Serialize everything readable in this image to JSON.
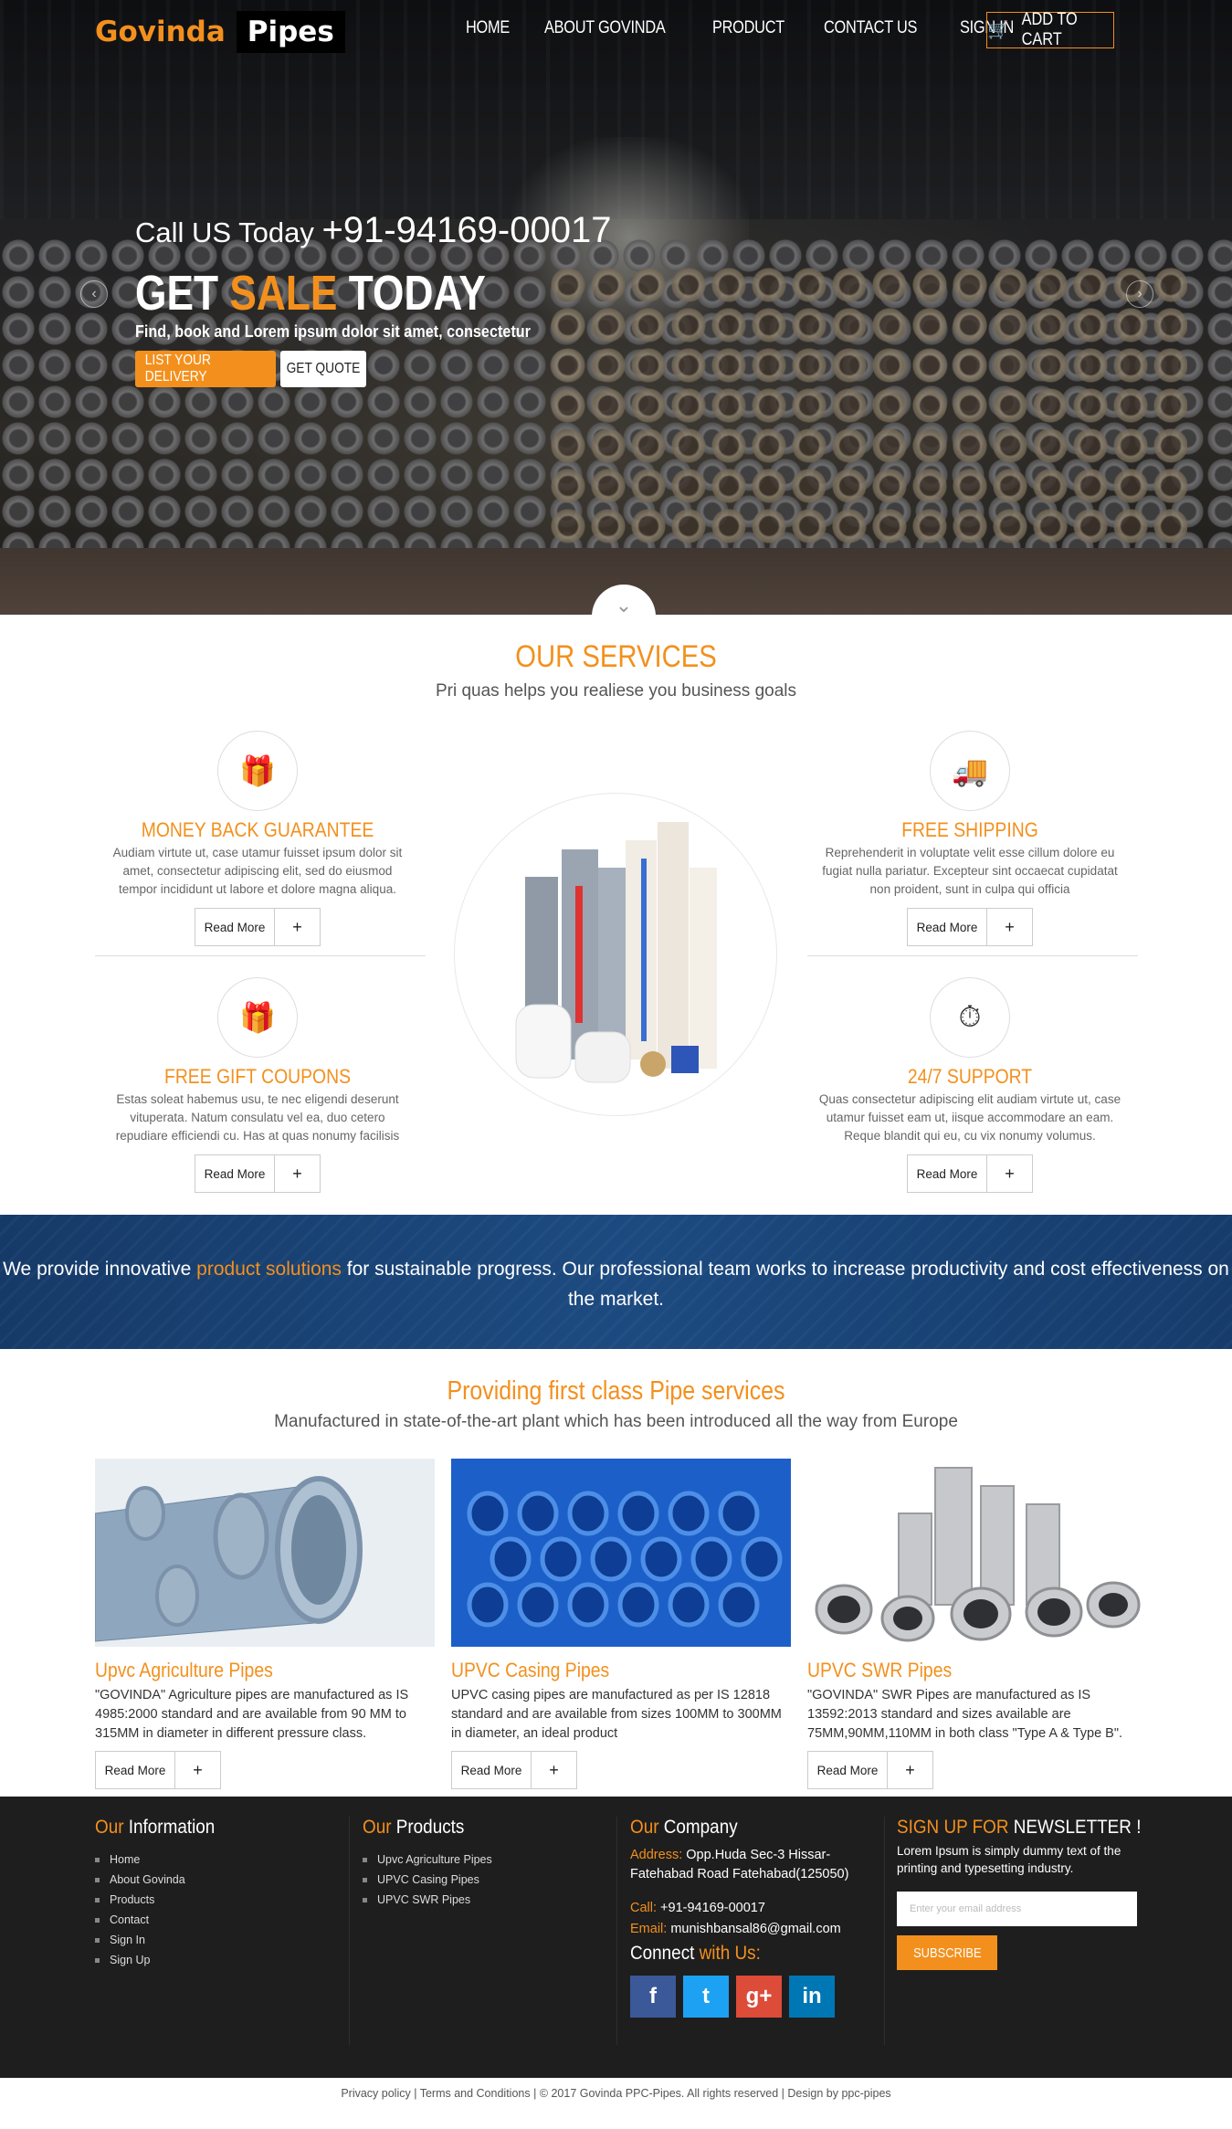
{
  "brand": {
    "part1": "Govinda",
    "part2": "Pipes"
  },
  "nav": [
    "HOME",
    "ABOUT GOVINDA",
    "PRODUCT",
    "CONTACT US",
    "SIGN IN"
  ],
  "cart_label": "ADD TO CART",
  "hero": {
    "call_prefix": "Call US Today",
    "phone": "+91-94169-00017",
    "headline_a": "GET",
    "headline_b": "SALE",
    "headline_c": "TODAY",
    "subtitle": "Find, book and Lorem ipsum dolor sit amet, consectetur",
    "btn_delivery": "LIST YOUR DELIVERY",
    "btn_quote": "GET QUOTE"
  },
  "services": {
    "title": "OUR SERVICES",
    "subtitle": "Pri quas helps you realiese you business goals",
    "items": [
      {
        "title": "MONEY BACK GUARANTEE",
        "text": "Audiam virtute ut, case utamur fuisset ipsum dolor sit amet, consectetur adipiscing elit, sed do eiusmod tempor incididunt ut labore et dolore magna aliqua.",
        "icon": "gift-icon"
      },
      {
        "title": "FREE SHIPPING",
        "text": "Reprehenderit in voluptate velit esse cillum dolore eu fugiat nulla pariatur. Excepteur sint occaecat cupidatat non proident, sunt in culpa qui officia",
        "icon": "truck-icon"
      },
      {
        "title": "FREE GIFT COUPONS",
        "text": "Estas soleat habemus usu, te nec eligendi deserunt vituperata. Natum consulatu vel ea, duo cetero repudiare efficiendi cu. Has at quas nonumy facilisis",
        "icon": "gift-icon"
      },
      {
        "title": "24/7 SUPPORT",
        "text": "Quas consectetur adipiscing elit audiam virtute ut, case utamur fuisset eam ut, iisque accommodare an eam. Reque blandit qui eu, cu vix nonumy volumus.",
        "icon": "support-icon"
      }
    ],
    "read_more": "Read More",
    "plus": "+"
  },
  "banner": {
    "before": "We provide innovative ",
    "highlight": "product solutions",
    "after": " for sustainable progress. Our professional team works to increase productivity and cost effectiveness on the market."
  },
  "products": {
    "title": "Providing first class Pipe services",
    "subtitle": "Manufactured in state-of-the-art plant which has been introduced all the way from Europe",
    "items": [
      {
        "title": "Upvc Agriculture Pipes",
        "text": "\"GOVINDA\" Agriculture pipes are manufactured as IS 4985:2000 standard and are available from 90 MM to 315MM in diameter in different pressure class."
      },
      {
        "title": "UPVC Casing Pipes",
        "text": "UPVC casing pipes are manufactured as per IS 12818 standard and are available from sizes 100MM to 300MM in diameter, an ideal product"
      },
      {
        "title": "UPVC SWR Pipes",
        "text": "\"GOVINDA\" SWR Pipes are manufactured as IS 13592:2013 standard and sizes available are 75MM,90MM,110MM in both class \"Type A & Type B\"."
      }
    ]
  },
  "footer": {
    "info": {
      "title_a": "Our",
      "title_b": " Information",
      "links": [
        "Home",
        "About Govinda",
        "Products",
        "Contact",
        "Sign In",
        "Sign Up"
      ]
    },
    "products": {
      "title_a": "Our",
      "title_b": " Products",
      "links": [
        "Upvc Agriculture Pipes",
        "UPVC Casing Pipes",
        "UPVC SWR Pipes"
      ]
    },
    "company": {
      "title_a": "Our",
      "title_b": " Company",
      "address_label": "Address:",
      "address": " Opp.Huda Sec-3 Hissar-Fatehabad Road Fatehabad(125050)",
      "call_label": "Call:",
      "call": " +91-94169-00017",
      "email_label": "Email:",
      "email": " munishbansal86@gmail.com",
      "connect_a": "Connect",
      "connect_b": " with Us:"
    },
    "newsletter": {
      "title_a": "SIGN UP FOR",
      "title_b": " NEWSLETTER !",
      "text": "Lorem Ipsum is simply dummy text of the printing and typesetting industry.",
      "placeholder": "Enter your email address",
      "button": "SUBSCRIBE"
    },
    "social": [
      {
        "icon": "facebook-icon",
        "glyph": "f",
        "color": "#3b5998"
      },
      {
        "icon": "twitter-icon",
        "glyph": "t",
        "color": "#1da1f2"
      },
      {
        "icon": "google-plus-icon",
        "glyph": "g+",
        "color": "#dd4b39"
      },
      {
        "icon": "linkedin-icon",
        "glyph": "in",
        "color": "#0077b5"
      }
    ],
    "copyright": "Privacy policy | Terms and Conditions | © 2017 Govinda PPC-Pipes. All rights reserved | Design by ppc-pipes"
  },
  "colors": {
    "accent": "#f3901d",
    "banner": "#1c4a80",
    "footer": "#1e1e1e"
  }
}
